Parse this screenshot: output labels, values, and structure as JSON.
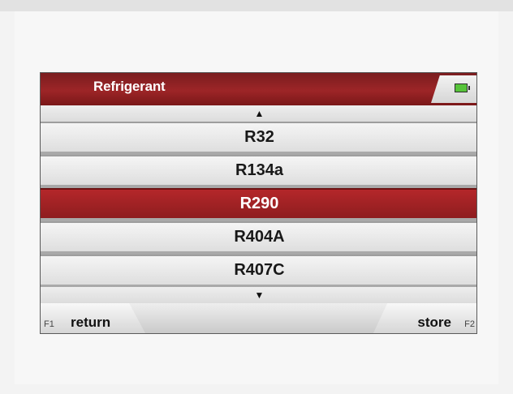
{
  "screen": {
    "title": "Refrigerant",
    "battery_status": "battery-full-icon",
    "arrows": {
      "up": "▲",
      "down": "▼"
    },
    "refrigerants": [
      {
        "label": "R32",
        "selected": false
      },
      {
        "label": "R134a",
        "selected": false
      },
      {
        "label": "R290",
        "selected": true
      },
      {
        "label": "R404A",
        "selected": false
      },
      {
        "label": "R407C",
        "selected": false
      }
    ],
    "softkeys": {
      "left_function": "F1",
      "left_label": "return",
      "right_function": "F2",
      "right_label": "store"
    },
    "colors": {
      "accent": "#9d2527",
      "battery_green": "#57c43a"
    }
  }
}
